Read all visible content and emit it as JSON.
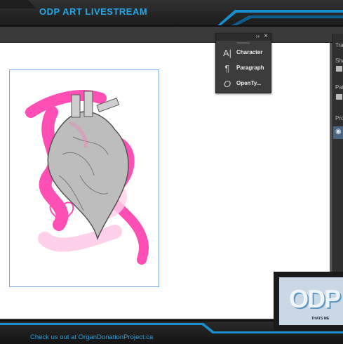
{
  "header": {
    "title": "ODP ART LIVESTREAM"
  },
  "footer": {
    "link_text": "Check us out at OrganDonationProject.ca"
  },
  "float_panel": {
    "items": [
      {
        "label": "Character",
        "icon": "character-icon"
      },
      {
        "label": "Paragraph",
        "icon": "paragraph-icon"
      },
      {
        "label": "OpenTy...",
        "icon": "opentype-icon"
      }
    ]
  },
  "right_panel": {
    "headings": [
      "Tra",
      "Sha",
      "Path",
      "Pro"
    ]
  },
  "webcam": {
    "logo_text": "ODP",
    "caption": "THATS ME"
  },
  "colors": {
    "accent": "#27a6e6",
    "brush": "#ff4fb4",
    "canvas": "#ffffff"
  }
}
